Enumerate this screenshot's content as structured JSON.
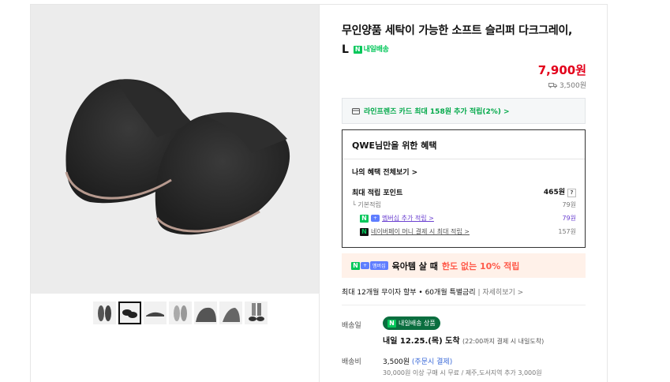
{
  "product": {
    "title_line1": "무인양품 세탁이 가능한 소프트 슬리퍼 다크그레이,",
    "title_line2": "L",
    "delivery_badge": "내일배송"
  },
  "price": {
    "value": "7,900원",
    "shipping": "3,500원"
  },
  "card_promo": "라인프렌즈 카드 최대 158원 추가 적립(2%) >",
  "benefit": {
    "heading": "QWE님만을 위한 혜택",
    "view_all": "나의 혜택 전체보기 >",
    "max_label": "최대 적립 포인트",
    "max_value": "465원",
    "help": "?",
    "basic_label": "기본적립",
    "basic_value": "79원",
    "member_label": "멤버십 추가 적립 >",
    "member_value": "79원",
    "npay_label": "네이버페이 머니 결제 시 최대 적립 >",
    "npay_value": "157원"
  },
  "promo": {
    "tag": "멤버십",
    "text1": "육아템 살 때",
    "text2": "한도 없는 10% 적립"
  },
  "installment": {
    "text": "최대 12개월 무이자 할부 • 60개월 특별금리",
    "link": "자세히보기 >"
  },
  "delivery": {
    "label": "배송일",
    "pill": "내일배송 상품",
    "arrive": "내일 12.25.(목) 도착",
    "arrive_note": "(22:00까지 결제 시 내일도착)"
  },
  "fee": {
    "label": "배송비",
    "amount": "3,500원",
    "note": "(주문시 결제)",
    "sub": "30,000원 이상 구매 시 무료 / 제주,도서지역 추가 3,000원"
  },
  "thumbnails": [
    "slippers-pair",
    "slippers-top",
    "slipper-side",
    "slippers-white",
    "slipper-gray",
    "slipper-profile",
    "slippers-worn"
  ],
  "colors": {
    "accent_red": "#e3001b",
    "naver_green": "#03c75a",
    "promo_red": "#ff5a4a",
    "member_purple": "#6a3fd0"
  }
}
